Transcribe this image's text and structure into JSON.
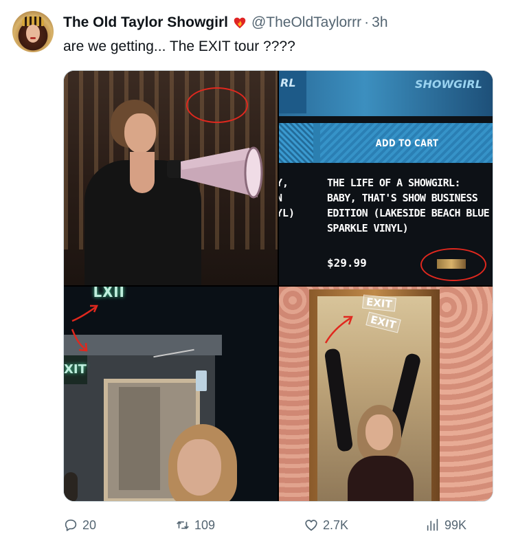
{
  "author": {
    "display_name": "The Old Taylor Showgirl",
    "handle": "@TheOldTaylorrr",
    "separator": "·",
    "time": "3h",
    "badge_icon": "heart-fire-icon"
  },
  "tweet": {
    "text": "are we getting... The EXIT tour ????"
  },
  "media": {
    "product": {
      "banner_word": "SHOWGIRL",
      "banner_left_word": "RL",
      "add_to_cart": "ADD TO CART",
      "edge_text": [
        "Y,",
        "N",
        "YL)"
      ],
      "title": "THE LIFE OF A SHOWGIRL: BABY, THAT'S SHOW BUSINESS EDITION (LAKESIDE BEACH BLUE SPARKLE VINYL)",
      "price": "$29.99"
    },
    "door_scene": {
      "exit_top": "LXII",
      "exit_side": "XIT"
    },
    "mirror_scene": {
      "exit_tag_1": "EXIT",
      "exit_tag_2": "EXIT"
    },
    "annotation_color": "#e0281e"
  },
  "actions": {
    "replies": "20",
    "retweets": "109",
    "likes": "2.7K",
    "views": "99K"
  }
}
